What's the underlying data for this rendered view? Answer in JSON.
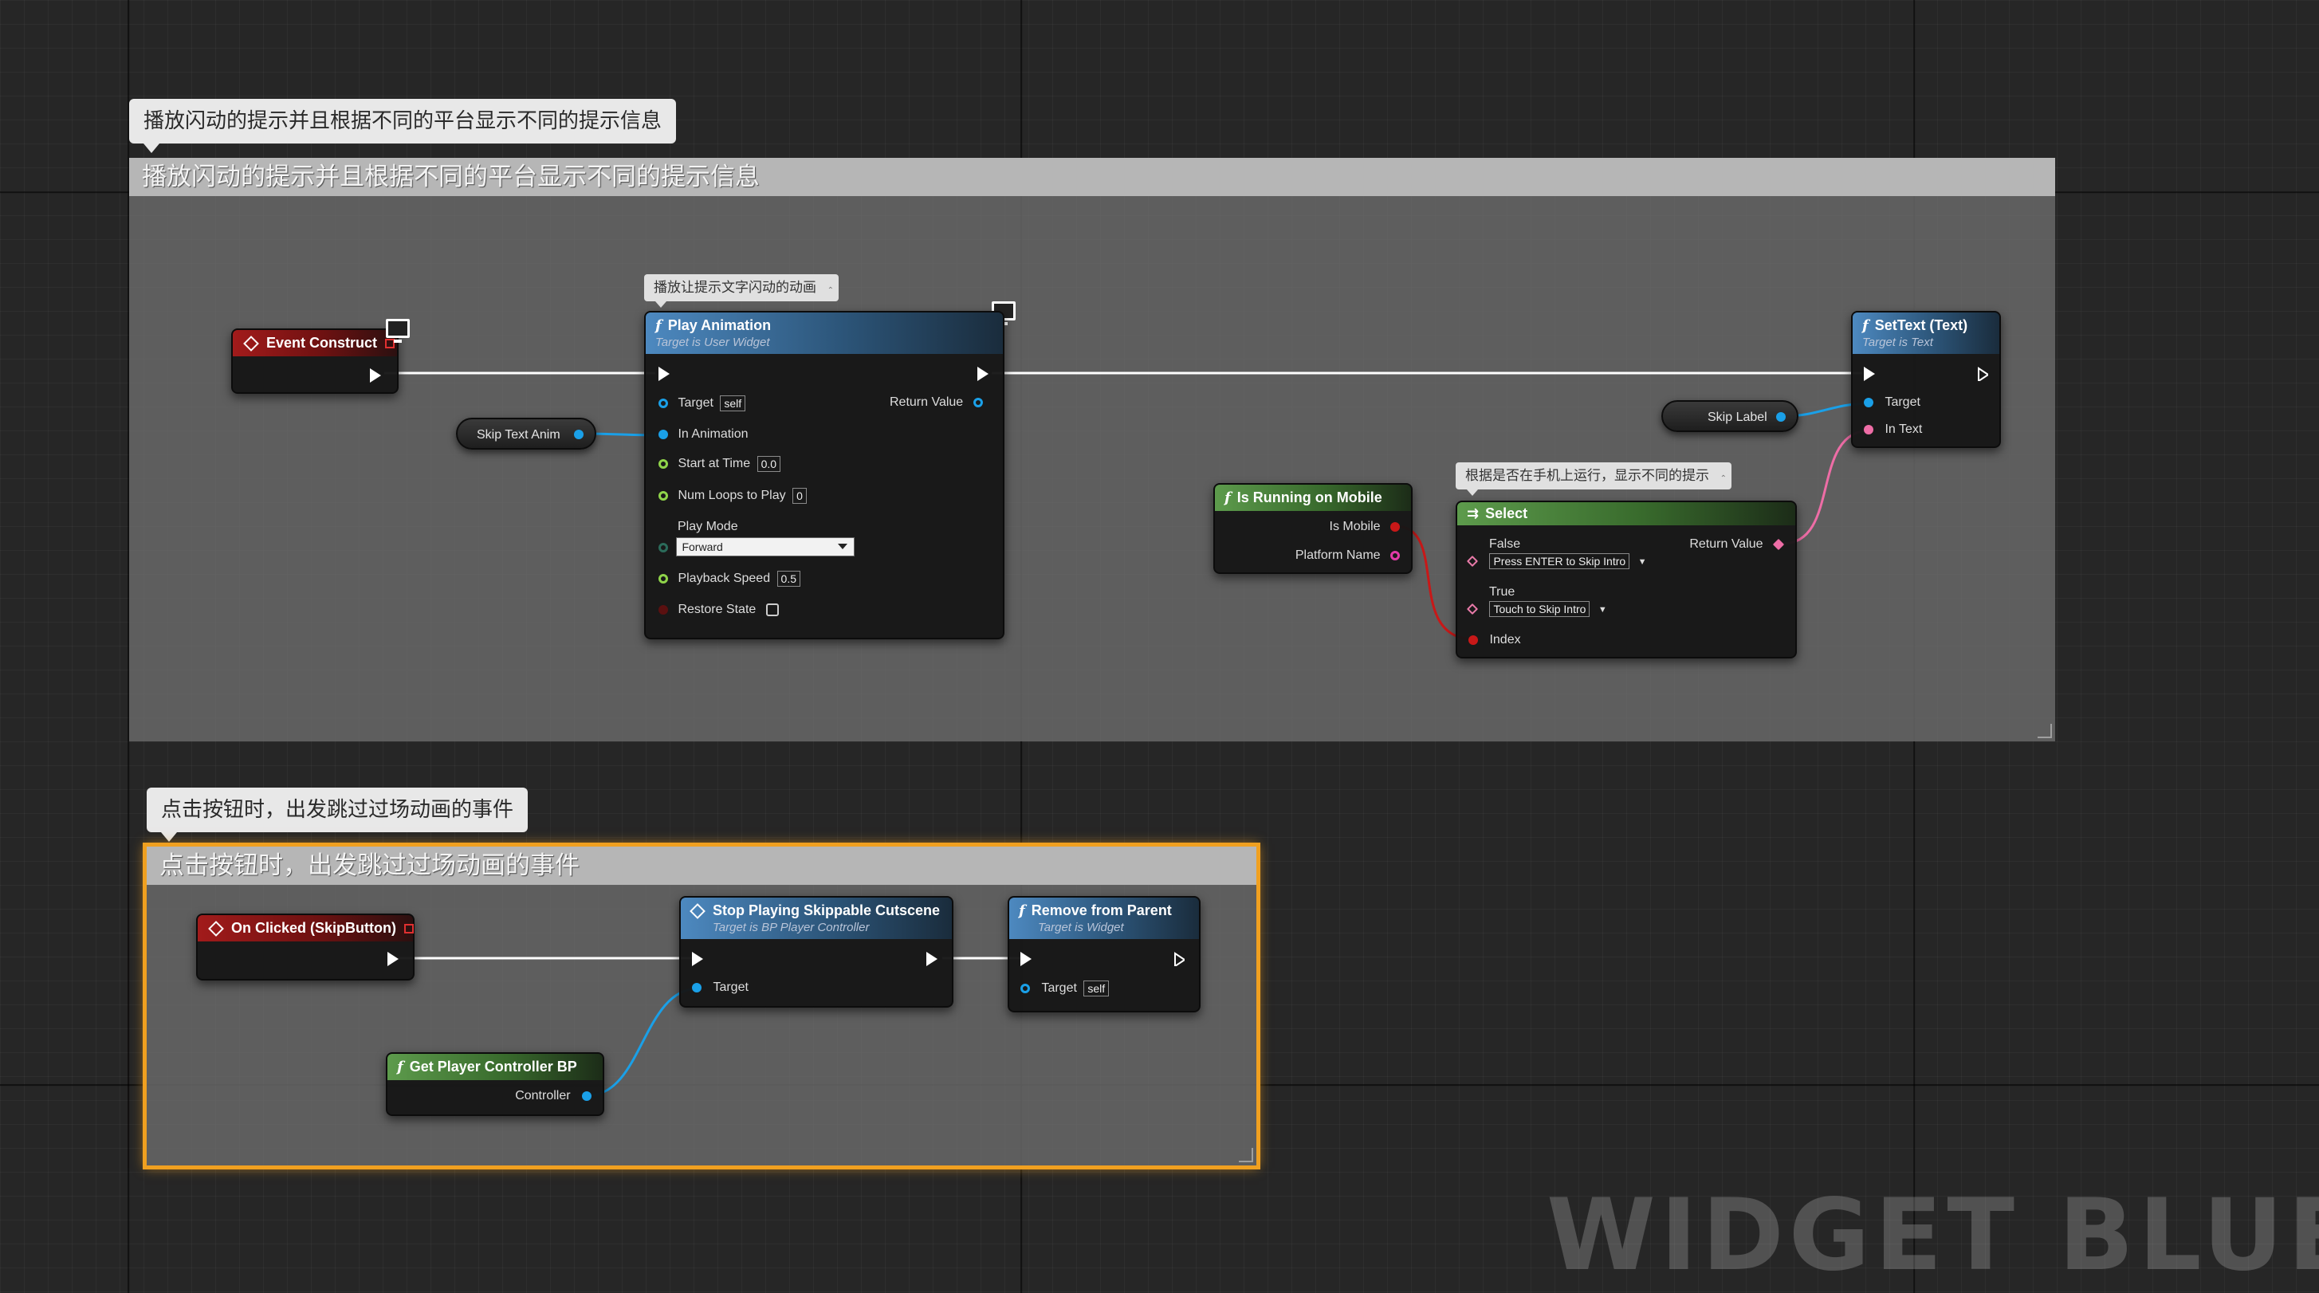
{
  "watermark": "WIDGET BLUEPRINT",
  "group1": {
    "bubble": "播放闪动的提示并且根据不同的平台显示不同的提示信息",
    "title": "播放闪动的提示并且根据不同的平台显示不同的提示信息"
  },
  "group2": {
    "bubble": "点击按钮时，出发跳过过场动画的事件",
    "title": "点击按钮时，出发跳过过场动画的事件"
  },
  "event_construct": {
    "title": "Event Construct"
  },
  "skip_text_anim": {
    "label": "Skip Text Anim"
  },
  "play_animation": {
    "comment": "播放让提示文字闪动的动画",
    "title": "Play Animation",
    "subtitle": "Target is User Widget",
    "target_label": "Target",
    "target_value": "self",
    "return_label": "Return Value",
    "in_animation": "In Animation",
    "start_time_label": "Start at Time",
    "start_time_value": "0.0",
    "loops_label": "Num Loops to Play",
    "loops_value": "0",
    "play_mode_label": "Play Mode",
    "play_mode_value": "Forward",
    "speed_label": "Playback Speed",
    "speed_value": "0.5",
    "restore_label": "Restore State"
  },
  "is_running_mobile": {
    "title": "Is Running on Mobile",
    "is_mobile": "Is Mobile",
    "platform_name": "Platform Name"
  },
  "select_node": {
    "comment": "根据是否在手机上运行，显示不同的提示",
    "title": "Select",
    "false_label": "False",
    "false_value": "Press ENTER to Skip Intro",
    "true_label": "True",
    "true_value": "Touch to Skip Intro",
    "return_label": "Return Value",
    "index_label": "Index"
  },
  "skip_label": {
    "label": "Skip Label"
  },
  "set_text": {
    "title": "SetText (Text)",
    "subtitle": "Target is Text",
    "target_label": "Target",
    "in_text_label": "In Text"
  },
  "on_clicked": {
    "title": "On Clicked (SkipButton)"
  },
  "stop_cutscene": {
    "title": "Stop Playing Skippable Cutscene",
    "subtitle": "Target is BP Player Controller",
    "target_label": "Target"
  },
  "remove_parent": {
    "title": "Remove from Parent",
    "subtitle": "Target is Widget",
    "target_label": "Target",
    "target_value": "self"
  },
  "get_pc": {
    "title": "Get Player Controller BP",
    "controller_label": "Controller"
  },
  "colors": {
    "exec_wire": "#ffffff",
    "object_wire": "#1aa0e8",
    "bool_wire": "#c81818",
    "text_wire": "#ee6da6",
    "selection": "#f0a020"
  }
}
